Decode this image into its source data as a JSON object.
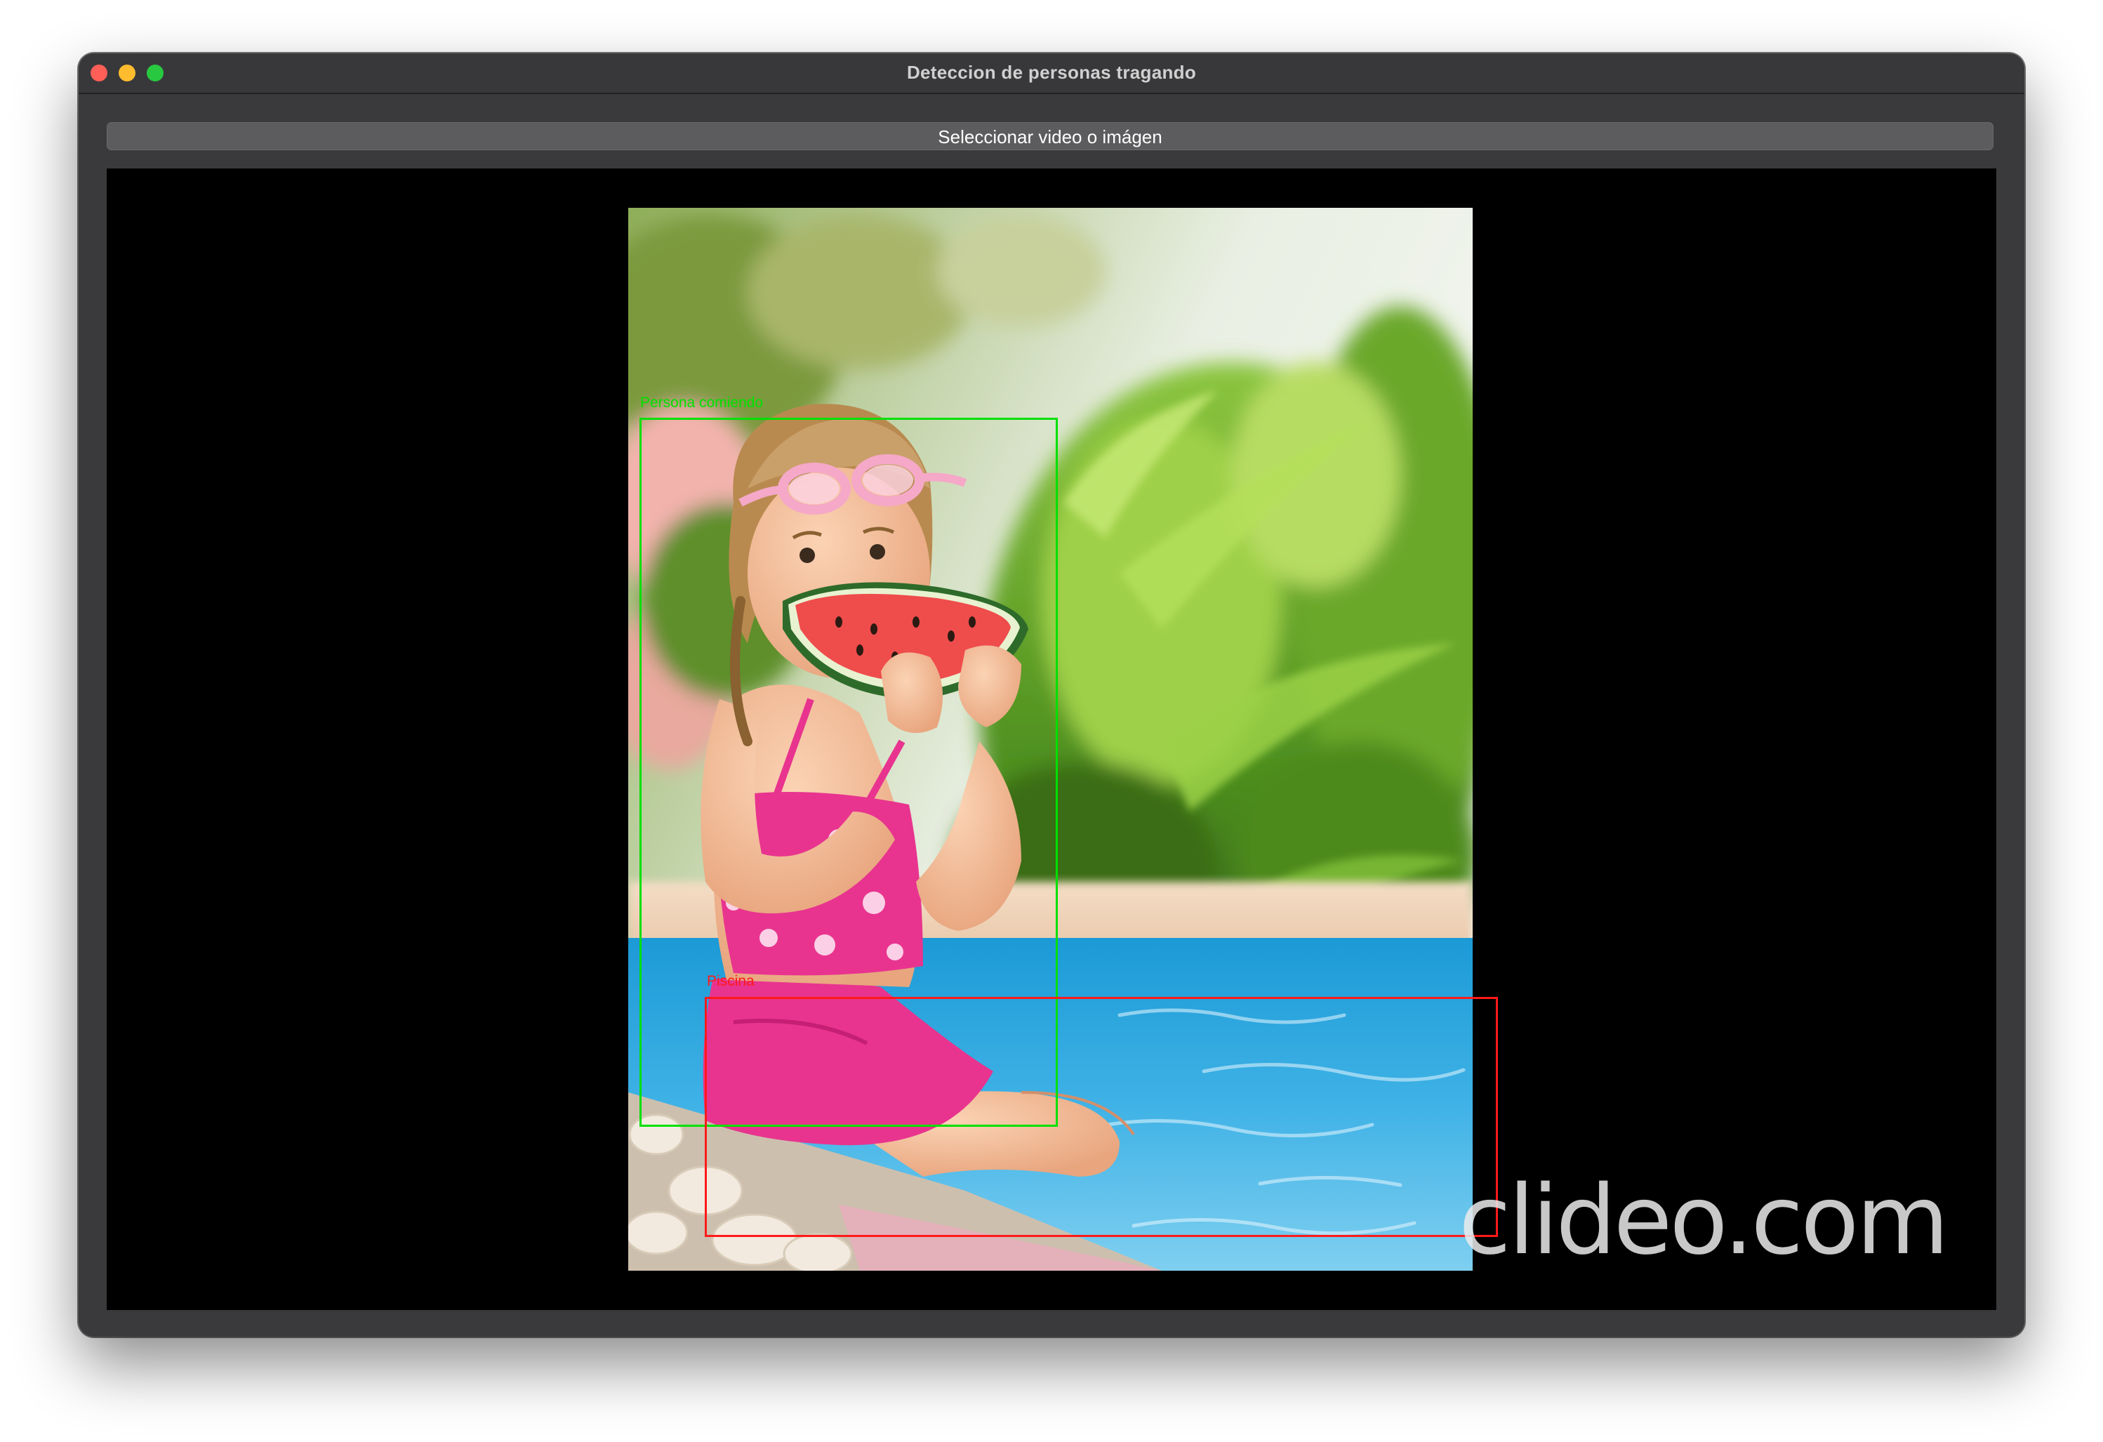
{
  "window": {
    "title": "Deteccion de personas tragando"
  },
  "toolbar": {
    "select_label": "Seleccionar video o imágen"
  },
  "detections": [
    {
      "label": "Persona comiendo",
      "color": "#00e000"
    },
    {
      "label": "Piscina",
      "color": "#ff1a1a"
    }
  ],
  "watermark": {
    "text": "clideo.com"
  },
  "colors": {
    "window_bg": "#3a3a3c",
    "viewer_bg": "#000000",
    "button_bg": "#5c5c5e"
  }
}
